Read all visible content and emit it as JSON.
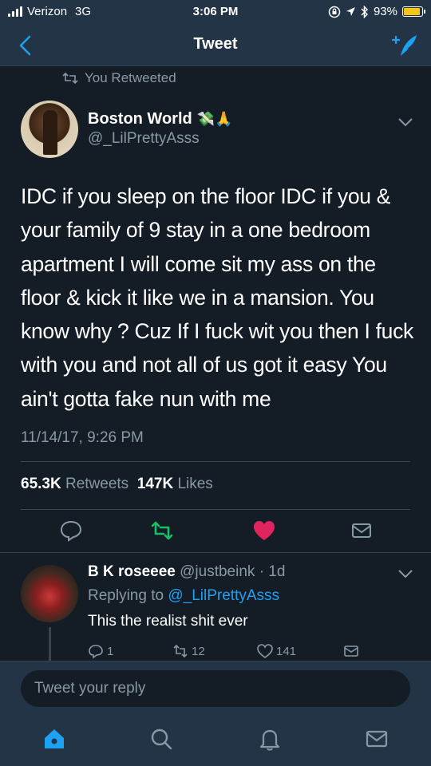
{
  "status_bar": {
    "carrier": "Verizon",
    "network": "3G",
    "time": "3:06 PM",
    "battery": "93%",
    "battery_level": 0.93
  },
  "nav": {
    "title": "Tweet"
  },
  "retweet_note": "You Retweeted",
  "tweet": {
    "author_name": "Boston World",
    "author_emoji": "💸🙏",
    "author_handle": "@_LilPrettyAsss",
    "text": "IDC if you sleep on the floor IDC if you & your family of 9 stay in a one bedroom apartment I will come sit my ass on the floor & kick it like we in a mansion. You know why ? Cuz If I fuck wit you then I fuck with you and not all of us got it easy You ain't gotta fake nun with me",
    "timestamp": "11/14/17, 9:26 PM",
    "retweets_count": "65.3K",
    "retweets_label": "Retweets",
    "likes_count": "147K",
    "likes_label": "Likes"
  },
  "reply": {
    "author_name": "B K roseeee",
    "author_handle": "@justbeink",
    "age": "· 1d",
    "replying_to_label": "Replying to",
    "replying_to_handle": "@_LilPrettyAsss",
    "text": "This the realist shit ever",
    "reply_count": "1",
    "retweet_count": "12",
    "like_count": "141"
  },
  "compose": {
    "placeholder": "Tweet your reply"
  },
  "colors": {
    "background": "#141d26",
    "bar": "#243447",
    "accent_blue": "#1da1f2",
    "retweet_green": "#17bf63",
    "like_red": "#e0245e",
    "muted": "#8899a6"
  }
}
